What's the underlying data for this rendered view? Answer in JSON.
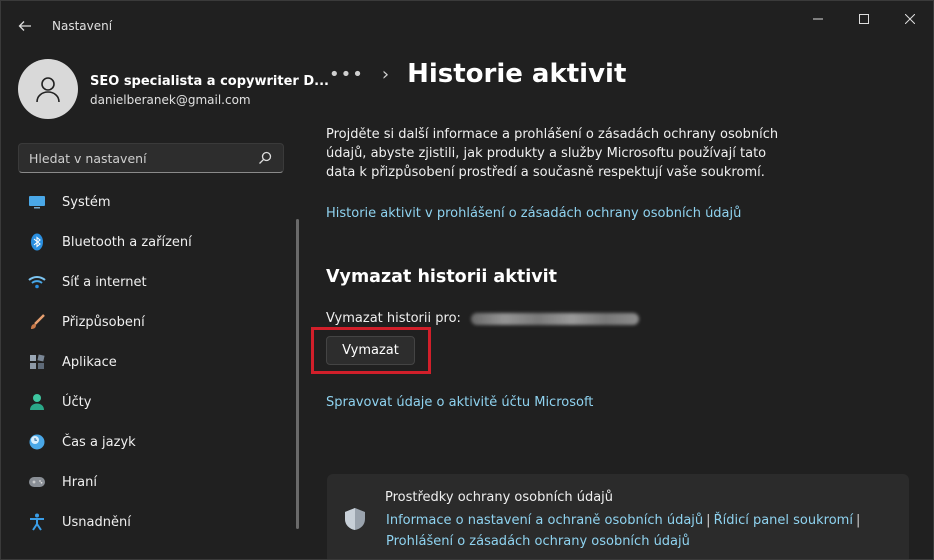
{
  "window": {
    "app_title": "Nastavení",
    "controls": {
      "minimize": "—",
      "maximize": "☐",
      "close": "✕"
    },
    "back_icon": "arrow-left-icon"
  },
  "sidebar": {
    "user_name": "SEO specialista a copywriter D...",
    "user_email": "danielberanek@gmail.com",
    "search_placeholder": "Hledat v nastavení",
    "items": [
      {
        "label": "Systém",
        "icon": "system-icon"
      },
      {
        "label": "Bluetooth a zařízení",
        "icon": "bluetooth-icon"
      },
      {
        "label": "Síť a internet",
        "icon": "wifi-icon"
      },
      {
        "label": "Přizpůsobení",
        "icon": "brush-icon"
      },
      {
        "label": "Aplikace",
        "icon": "apps-icon"
      },
      {
        "label": "Účty",
        "icon": "accounts-icon"
      },
      {
        "label": "Čas a jazyk",
        "icon": "time-language-icon"
      },
      {
        "label": "Hraní",
        "icon": "gaming-icon"
      },
      {
        "label": "Usnadnění",
        "icon": "accessibility-icon"
      }
    ]
  },
  "main": {
    "breadcrumb_more": "•••",
    "breadcrumb_sep": "›",
    "title": "Historie aktivit",
    "description": "Projděte si další informace a prohlášení o zásadách ochrany osobních údajů, abyste zjistili, jak produkty a služby Microsoftu používají tato data k přizpůsobení prostředí a současně respektují vaše soukromí.",
    "history_link": "Historie aktivit v prohlášení o zásadách ochrany osobních údajů",
    "clear_section_title": "Vymazat historii aktivit",
    "clear_for_label": "Vymazat historii pro:",
    "clear_button": "Vymazat",
    "manage_link": "Spravovat údaje o aktivitě účtu Microsoft",
    "privacy_card": {
      "title": "Prostředky ochrany osobních údajů",
      "link_settings": "Informace o nastavení a ochraně osobních údajů",
      "link_dashboard": "Řídicí panel soukromí",
      "link_statement": "Prohlášení o zásadách ochrany osobních údajů",
      "separator": "|"
    }
  },
  "colors": {
    "background": "#202020",
    "link": "#8fd3f0",
    "highlight_border": "#d11f2a"
  }
}
